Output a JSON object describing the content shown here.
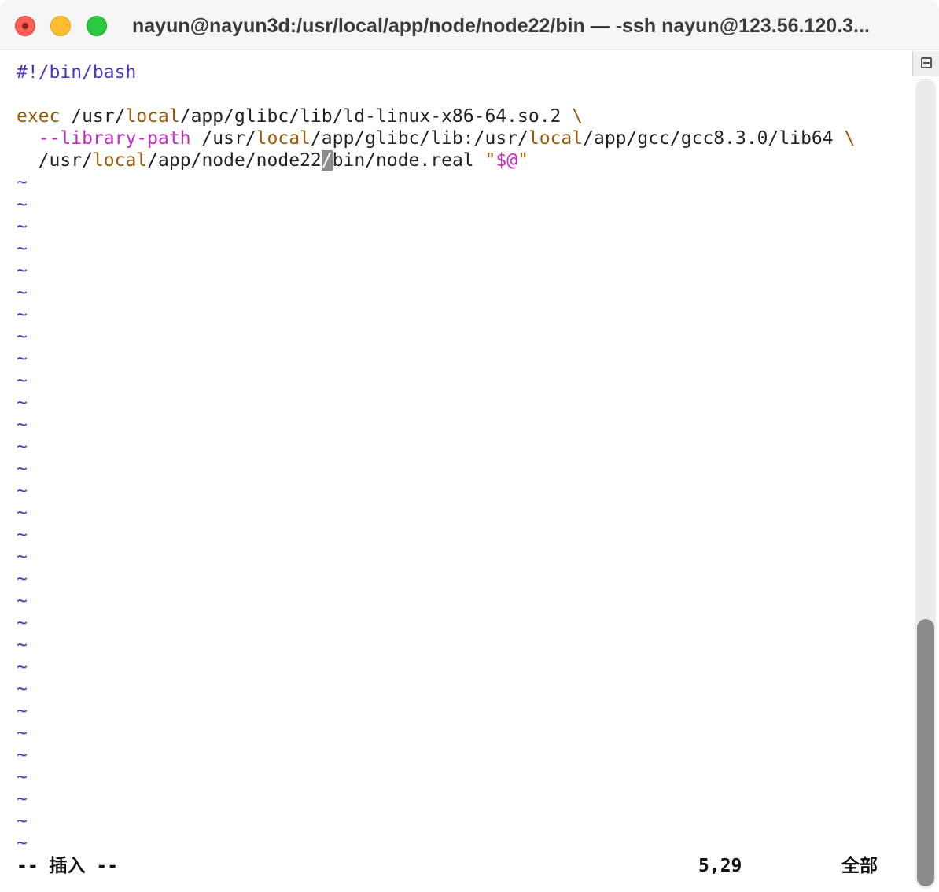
{
  "window": {
    "title": "nayun@nayun3d:/usr/local/app/node/node22/bin — -ssh nayun@123.56.120.3..."
  },
  "editor": {
    "shebang": "#!/bin/bash",
    "line3": {
      "kw": "exec",
      "p1": " /usr/",
      "local": "local",
      "p2": "/app/glibc/lib/ld-linux-x86-64.so.2 ",
      "bs": "\\"
    },
    "line4": {
      "indent": "  ",
      "opt": "--library-path",
      "p1": " /usr/",
      "local1": "local",
      "p2": "/app/glibc/lib:/usr/",
      "local2": "local",
      "p3": "/app/gcc/gcc8.3.0/lib64 ",
      "bs": "\\"
    },
    "line5": {
      "indent": "  ",
      "p1": "/usr/",
      "local": "local",
      "p2": "/app/node/node22",
      "cursor_char": "/",
      "p3": "bin/node.real ",
      "q1": "\"",
      "str": "$@",
      "q2": "\""
    },
    "tilde": "~"
  },
  "statusline": {
    "mode": "-- 插入 --",
    "position": "5,29",
    "scope": "全部"
  },
  "colors": {
    "shebang": "#4b36c8",
    "keyword": "#9c5a08",
    "option": "#c42ac4",
    "tilde": "#4b36c8",
    "cursor": "#8c8c8c"
  }
}
